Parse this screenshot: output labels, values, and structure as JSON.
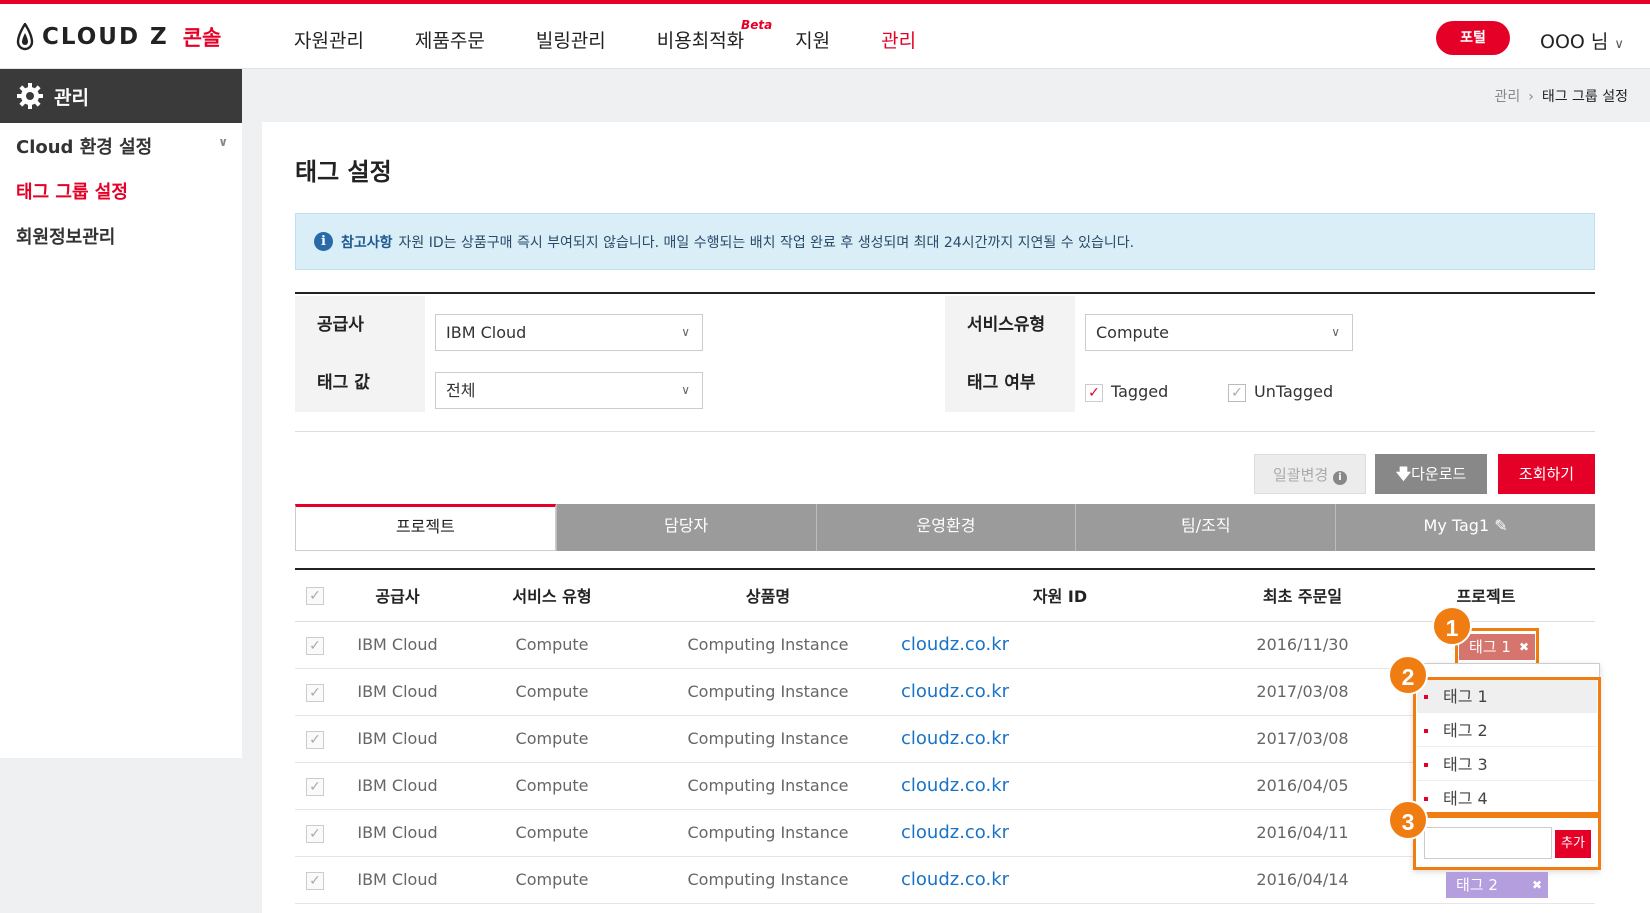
{
  "brand": {
    "name": "CLOUD Z",
    "sub": "콘솔"
  },
  "nav": [
    {
      "label": "자원관리"
    },
    {
      "label": "제품주문"
    },
    {
      "label": "빌링관리"
    },
    {
      "label": "비용최적화",
      "badge": "Beta"
    },
    {
      "label": "지원"
    },
    {
      "label": "관리",
      "active": true
    }
  ],
  "header": {
    "portal_label": "포털",
    "user_label": "OOO 님"
  },
  "sidebar": {
    "title": "관리",
    "items": [
      {
        "label": "Cloud 환경 설정"
      },
      {
        "label": "태그 그룹 설정",
        "active": true
      },
      {
        "label": "회원정보관리"
      }
    ]
  },
  "breadcrumb": {
    "parent": "관리",
    "separator": "›",
    "current": "태그 그룹 설정"
  },
  "page": {
    "title": "태그 설정"
  },
  "notice": {
    "label": "참고사항",
    "text": "자원 ID는 상품구매 즉시 부여되지 않습니다. 매일 수행되는 배치 작업 완료 후 생성되며 최대 24시간까지 지연될 수 있습니다."
  },
  "filter": {
    "provider_label": "공급사",
    "provider_value": "IBM Cloud",
    "service_label": "서비스유형",
    "service_value": "Compute",
    "tagvalue_label": "태그 값",
    "tagvalue_value": "전체",
    "tagged_label": "태그 여부",
    "tagged_option": "Tagged",
    "untagged_option": "UnTagged"
  },
  "buttons": {
    "bulk_change": "일괄변경",
    "download": "다운로드",
    "search": "조회하기"
  },
  "tabs": [
    {
      "label": "프로젝트",
      "active": true
    },
    {
      "label": "담당자"
    },
    {
      "label": "운영환경"
    },
    {
      "label": "팀/조직"
    },
    {
      "label": "My Tag1"
    }
  ],
  "table": {
    "headers": [
      "공급사",
      "서비스 유형",
      "상품명",
      "자원 ID",
      "최초 주문일",
      "프로젝트"
    ],
    "rows": [
      {
        "provider": "IBM Cloud",
        "service": "Compute",
        "product": "Computing Instance",
        "resource": "cloudz.co.kr",
        "date": "2016/11/30"
      },
      {
        "provider": "IBM Cloud",
        "service": "Compute",
        "product": "Computing Instance",
        "resource": "cloudz.co.kr",
        "date": "2017/03/08"
      },
      {
        "provider": "IBM Cloud",
        "service": "Compute",
        "product": "Computing Instance",
        "resource": "cloudz.co.kr",
        "date": "2017/03/08"
      },
      {
        "provider": "IBM Cloud",
        "service": "Compute",
        "product": "Computing Instance",
        "resource": "cloudz.co.kr",
        "date": "2016/04/05"
      },
      {
        "provider": "IBM Cloud",
        "service": "Compute",
        "product": "Computing Instance",
        "resource": "cloudz.co.kr",
        "date": "2016/04/11"
      },
      {
        "provider": "IBM Cloud",
        "service": "Compute",
        "product": "Computing Instance",
        "resource": "cloudz.co.kr",
        "date": "2016/04/14"
      }
    ]
  },
  "tags": {
    "row1": "태그 1",
    "row6": "태그 2"
  },
  "dropdown": {
    "items": [
      "태그 1",
      "태그 2",
      "태그 3",
      "태그 4"
    ],
    "add_label": "추가"
  },
  "callouts": [
    "1",
    "2",
    "3"
  ],
  "colors": {
    "accent": "#e50027",
    "callout": "#f07d12",
    "tab_inactive": "#9b9b9b",
    "tag1": "#d6746e",
    "tag2": "#b49ede"
  }
}
